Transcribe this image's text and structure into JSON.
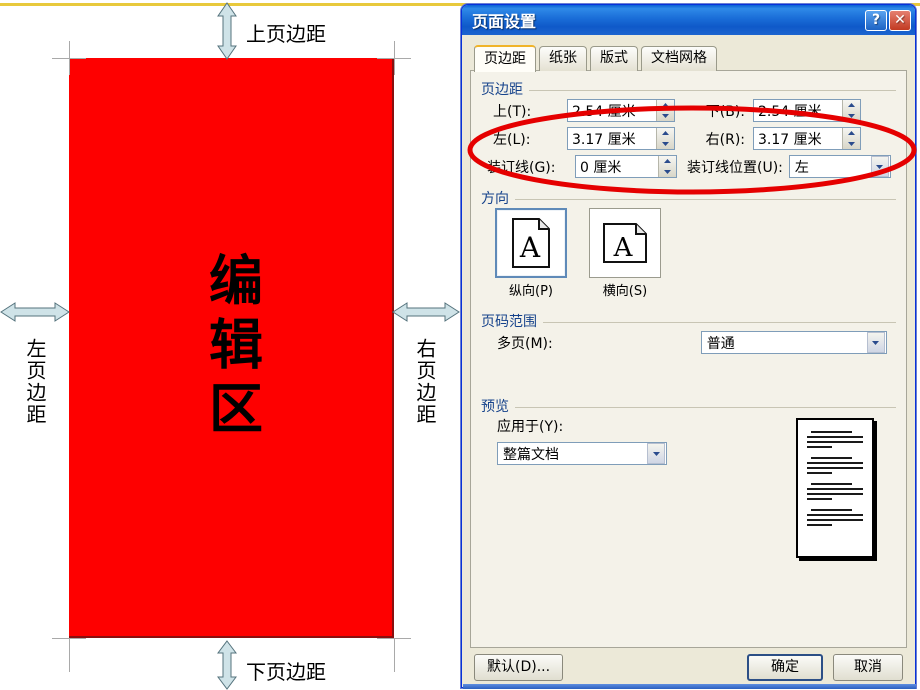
{
  "illustration": {
    "edit_area_label": "编辑区",
    "top_margin_label": "上页边距",
    "bottom_margin_label": "下页边距",
    "left_margin_label": "左页边距",
    "right_margin_label": "右页边距",
    "edit_area_color": "#fe0000",
    "arrow_color": "#cfe3e8"
  },
  "dialog": {
    "title": "页面设置",
    "help_button": "?",
    "close_button": "✕",
    "tabs": [
      {
        "label": "页边距",
        "active": true
      },
      {
        "label": "纸张",
        "active": false
      },
      {
        "label": "版式",
        "active": false
      },
      {
        "label": "文档网格",
        "active": false
      }
    ],
    "margins": {
      "group_title": "页边距",
      "top": {
        "label": "上(T):",
        "value": "2.54 厘米"
      },
      "bottom": {
        "label": "下(B):",
        "value": "2.54 厘米"
      },
      "left": {
        "label": "左(L):",
        "value": "3.17 厘米"
      },
      "right": {
        "label": "右(R):",
        "value": "3.17 厘米"
      },
      "gutter": {
        "label": "装订线(G):",
        "value": "0 厘米"
      },
      "gutter_position": {
        "label": "装订线位置(U):",
        "value": "左"
      }
    },
    "orientation": {
      "group_title": "方向",
      "portrait": {
        "label": "纵向(P)",
        "selected": true,
        "glyph": "A"
      },
      "landscape": {
        "label": "横向(S)",
        "selected": false,
        "glyph": "A"
      }
    },
    "page_range": {
      "group_title": "页码范围",
      "multiple_pages": {
        "label": "多页(M):",
        "value": "普通"
      }
    },
    "preview": {
      "group_title": "预览",
      "apply_to": {
        "label": "应用于(Y):",
        "value": "整篇文档"
      }
    },
    "buttons": {
      "default": "默认(D)...",
      "ok": "确定",
      "cancel": "取消"
    }
  },
  "annotation": {
    "highlight_color": "#e50000",
    "shape": "ellipse"
  }
}
